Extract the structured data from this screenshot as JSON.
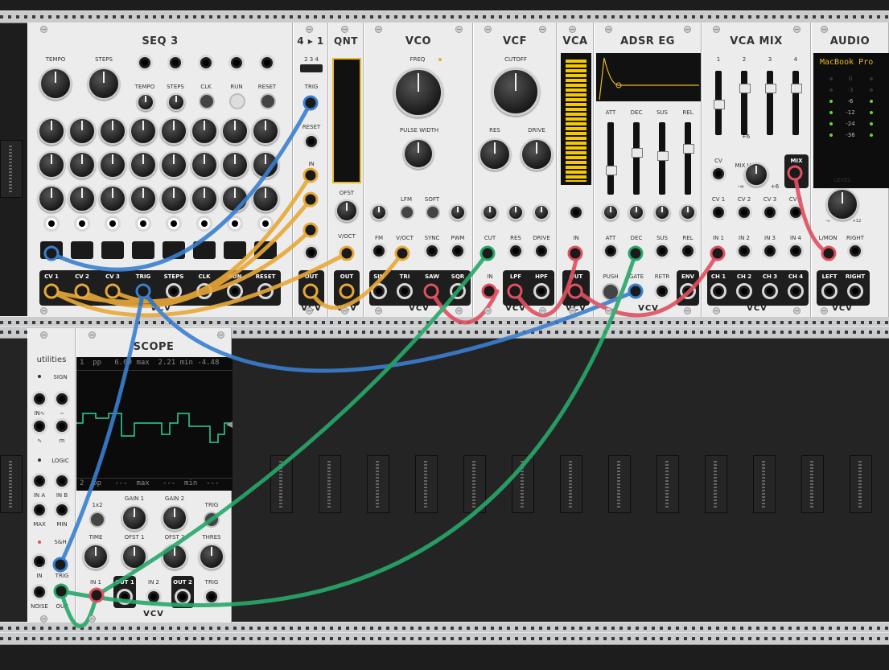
{
  "modules": {
    "seq3": {
      "title": "SEQ 3",
      "labels": {
        "tempo": "TEMPO",
        "steps": "STEPS",
        "tempo_s": "TEMPO",
        "steps_s": "STEPS",
        "clk": "CLK",
        "run": "RUN",
        "reset": "RESET"
      },
      "outputs": [
        "CV 1",
        "CV 2",
        "CV 3",
        "TRIG",
        "STEPS",
        "CLK",
        "RUN",
        "RESET"
      ]
    },
    "switch41": {
      "title": "4 ▸ 1",
      "steps": "2 3 4",
      "trig": "TRIG",
      "reset": "RESET",
      "in": "IN",
      "out": "OUT"
    },
    "qnt": {
      "title": "QNT",
      "ofst": "OFST",
      "voct": "V/OCT",
      "out": "OUT"
    },
    "vco": {
      "title": "VCO",
      "freq": "FREQ",
      "pulse_width": "PULSE WIDTH",
      "lfm": "LFM",
      "soft": "SOFT",
      "fm": "FM",
      "voct": "V/OCT",
      "sync": "SYNC",
      "pwm": "PWM",
      "sin": "SIN",
      "tri": "TRI",
      "saw": "SAW",
      "sqr": "SQR"
    },
    "vcf": {
      "title": "VCF",
      "cutoff": "CUTOFF",
      "res": "RES",
      "drive": "DRIVE",
      "cut": "CUT",
      "res_in": "RES",
      "drive_in": "DRIVE",
      "in": "IN",
      "lpf": "LPF",
      "hpf": "HPF"
    },
    "vca": {
      "title": "VCA",
      "in": "IN",
      "out": "OUT"
    },
    "adsr": {
      "title": "ADSR EG",
      "att": "ATT",
      "dec": "DEC",
      "sus": "SUS",
      "rel": "REL",
      "att2": "ATT",
      "dec2": "DEC",
      "sus2": "SUS",
      "rel2": "REL",
      "push": "PUSH",
      "gate": "GATE",
      "retr": "RETR",
      "env": "ENV"
    },
    "vcamix": {
      "title": "VCA MIX",
      "ch_labels": [
        "1",
        "2",
        "3",
        "4"
      ],
      "mix_lvl": "MIX LVL",
      "cv": "CV",
      "mix": "MIX",
      "minus_inf": "-∞",
      "plus6": "+6",
      "cv_in": [
        "CV 1",
        "CV 2",
        "CV 3",
        "CV 4"
      ],
      "in": [
        "IN 1",
        "IN 2",
        "IN 3",
        "IN 4"
      ],
      "ch": [
        "CH 1",
        "CH 2",
        "CH 3",
        "CH 4"
      ],
      "scale": [
        "+6",
        "- 0 -",
        "-∞"
      ]
    },
    "audio": {
      "title": "AUDIO",
      "device": "MacBook Pro",
      "meter": [
        "0",
        "-3",
        "-6",
        "-12",
        "-24",
        "-36"
      ],
      "level": "LEVEL",
      "lmin": "-∞",
      "lmax": "+12",
      "lmon": "L/MON",
      "right": "RIGHT",
      "left": "LEFT",
      "right2": "RIGHT"
    },
    "utilities": {
      "title": "utilities",
      "sign": "SIGN",
      "in_lbl": "IN∿",
      "out_lbl": "∽",
      "tilde": "∿",
      "m": "m",
      "logic": "LOGIC",
      "ina": "IN A",
      "inb": "IN B",
      "max": "MAX",
      "min": "MIN",
      "sh": "S&H",
      "in": "IN",
      "trig": "TRIG",
      "noise": "NOISE",
      "out": "OUT"
    },
    "scope": {
      "title": "SCOPE",
      "ch1_readout": "1  pp   6.69 max  2.21 min -4.48",
      "ch2_readout": "2  pp   ---  max   ---  min  ---",
      "x1x2": "1x2",
      "gain1": "GAIN 1",
      "gain2": "GAIN 2",
      "trig": "TRIG",
      "time": "TIME",
      "ofst1": "OFST 1",
      "ofst2": "OFST 2",
      "thres": "THRES",
      "in1": "IN 1",
      "out1": "OUT 1",
      "in2": "IN 2",
      "out2": "OUT 2",
      "trig_in": "TRIG"
    }
  },
  "brand": "VCV",
  "colors": {
    "panel": "#ececec",
    "blue": "#3a7fcf",
    "yellow": "#e8a838",
    "green": "#27a86a",
    "red": "#e05060",
    "rack": "#1d1d1d"
  }
}
